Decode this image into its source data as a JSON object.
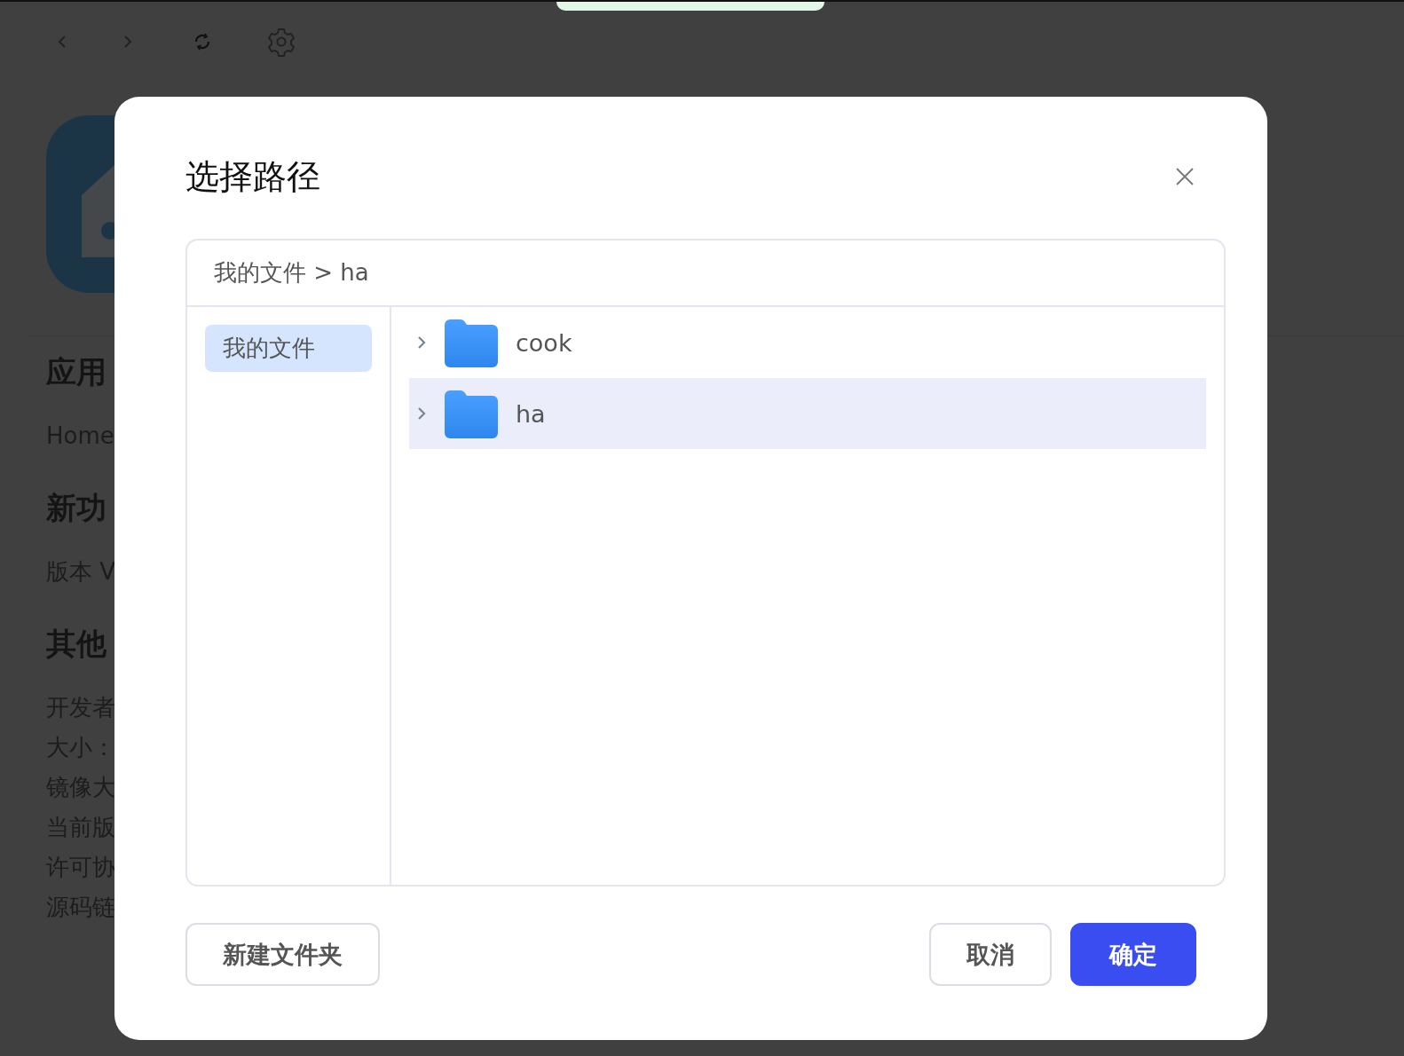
{
  "page": {
    "sections": [
      {
        "heading": "应用",
        "lines": [
          "Home"
        ]
      },
      {
        "heading": "新功",
        "lines": [
          "版本 V"
        ]
      },
      {
        "heading": "其他",
        "lines": [
          "开发者",
          "大小：",
          "镜像大",
          "当前版",
          "许可协",
          "源码链"
        ]
      }
    ]
  },
  "dialog": {
    "title": "选择路径",
    "breadcrumb": "我的文件 > ha",
    "sidebar": [
      {
        "label": "我的文件",
        "selected": true
      }
    ],
    "folders": [
      {
        "name": "cook",
        "selected": false
      },
      {
        "name": "ha",
        "selected": true
      }
    ],
    "new_folder_button": "新建文件夹",
    "buttons": [
      {
        "label": "取消",
        "kind": "default"
      },
      {
        "label": "确定",
        "kind": "primary"
      }
    ]
  }
}
